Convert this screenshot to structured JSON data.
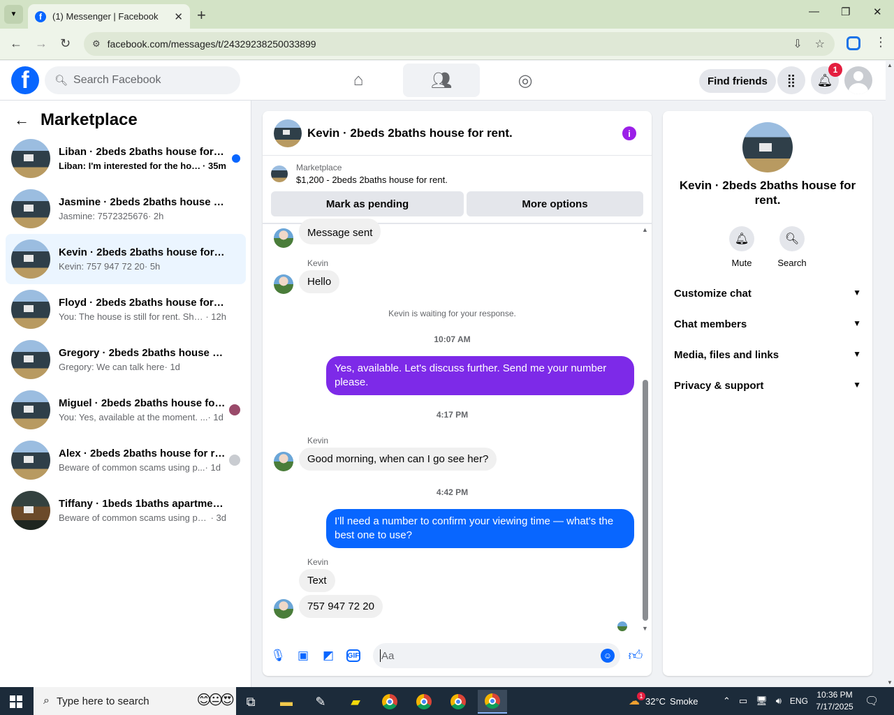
{
  "browser": {
    "tab_title": "(1) Messenger | Facebook",
    "url": "facebook.com/messages/t/24329238250033899"
  },
  "fb_header": {
    "search_placeholder": "Search Facebook",
    "find_friends": "Find friends",
    "notification_count": "1"
  },
  "sidebar": {
    "title": "Marketplace",
    "conversations": [
      {
        "name": "Liban · 2beds 2baths house for r...",
        "snippet": "Liban: I'm interested for the hou...",
        "time": " · 35m",
        "unread": true
      },
      {
        "name": "Jasmine · 2beds 2baths house for r...",
        "snippet": "Jasmine: 7572325676",
        "time": " · 2h"
      },
      {
        "name": "Kevin · 2beds 2baths house for rent.",
        "snippet": "Kevin: 757 947 72 20",
        "time": " · 5h",
        "active": true
      },
      {
        "name": "Floyd · 2beds 2baths house for rent.",
        "snippet": "You: The house is still for rent. Share ...",
        "time": " · 12h"
      },
      {
        "name": "Gregory · 2beds 2baths house for ...",
        "snippet": "Gregory: We can talk here",
        "time": " · 1d"
      },
      {
        "name": "Miguel · 2beds 2baths house for...",
        "snippet": "You: Yes, available at the moment. ...",
        "time": " · 1d"
      },
      {
        "name": "Alex · 2beds 2baths house for re...",
        "snippet": "Beware of common scams using p...",
        "time": " · 1d"
      },
      {
        "name": "Tiffany · 1beds 1baths apartment f...",
        "snippet": "Beware of common scams using pay...",
        "time": " · 3d"
      }
    ]
  },
  "chat": {
    "title": "Kevin · 2beds 2baths house for rent.",
    "listing_label": "Marketplace",
    "listing_price": "$1,200 - 2beds 2baths house for rent.",
    "mark_pending": "Mark as pending",
    "more_options": "More options",
    "messages": {
      "m1": "Message sent",
      "sender1": "Kevin",
      "m2": "Hello",
      "waiting": "Kevin is waiting for your response.",
      "time1": "10:07 AM",
      "out1": "Yes, available. Let's discuss further. Send me your number please.",
      "time2": "4:17 PM",
      "sender2": "Kevin",
      "m3": "Good morning, when can I go see her?",
      "time3": "4:42 PM",
      "out2": "I'll need a number to confirm your viewing time — what's the best one to use?",
      "sender3": "Kevin",
      "m4": "Text",
      "m5": "757 947 72 20"
    },
    "composer_placeholder": "Aa",
    "colors": {
      "purple": "#7d2ae8",
      "blue": "#0866ff"
    }
  },
  "right_panel": {
    "title": "Kevin · 2beds 2baths house for rent.",
    "mute": "Mute",
    "search": "Search",
    "sections": [
      "Customize chat",
      "Chat members",
      "Media, files and links",
      "Privacy & support"
    ]
  },
  "taskbar": {
    "search_placeholder": "Type here to search",
    "weather_temp": "32°C",
    "weather_desc": "Smoke",
    "weather_badge": "1",
    "lang": "ENG",
    "time": "10:36 PM",
    "date": "7/17/2025"
  }
}
